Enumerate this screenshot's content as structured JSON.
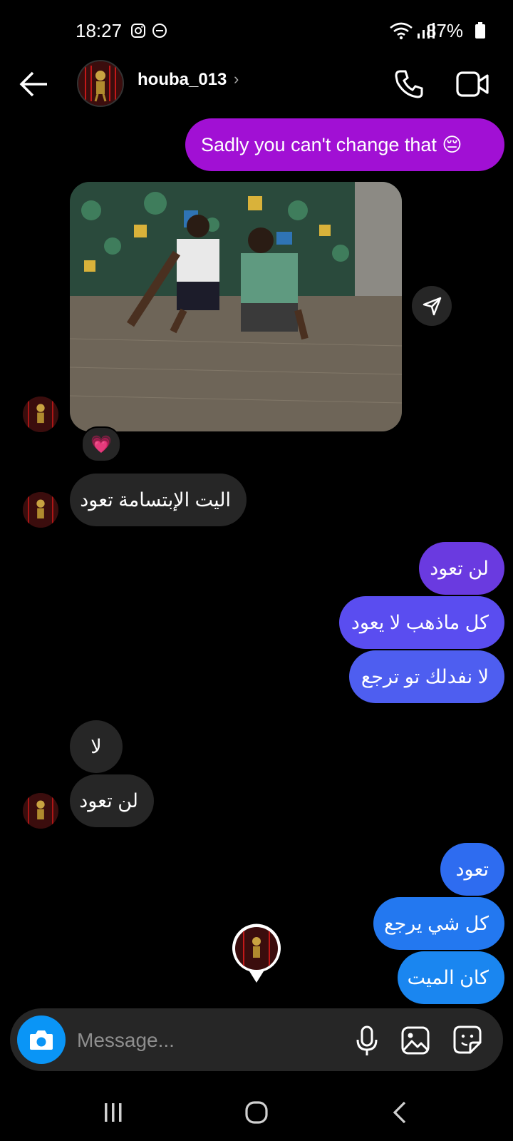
{
  "status": {
    "time": "18:27",
    "battery": "87%"
  },
  "header": {
    "username": "houba_013",
    "chevron": "›"
  },
  "messages": {
    "m1": "Sadly you can't change that 😔",
    "m2": "اليت الإبتسامة تعود",
    "m3": "لن تعود",
    "m4": "كل ماذهب لا يعود",
    "m5": "لا نفدلك تو ترجع",
    "m6": "لا",
    "m7": "لن تعود",
    "m8": "تعود",
    "m9": "كل شي يرجع",
    "m10": "كان الميت"
  },
  "reaction": {
    "emoji": "💗"
  },
  "composer": {
    "placeholder": "Message..."
  },
  "colors": {
    "purple": "#a110d4",
    "violet_top": "#6a3ae0",
    "violet": "#5a4df0",
    "blue_mid": "#2e6cf0",
    "blue": "#1a86f0",
    "incoming": "#262626",
    "camera": "#0a95f6"
  },
  "icons": [
    "instagram-icon",
    "dnd-icon",
    "wifi-icon",
    "signal-icon",
    "battery-icon",
    "back-arrow-icon",
    "phone-icon",
    "video-icon",
    "share-icon",
    "camera-icon",
    "mic-icon",
    "gallery-icon",
    "sticker-icon",
    "recents-icon",
    "home-icon",
    "nav-back-icon"
  ]
}
